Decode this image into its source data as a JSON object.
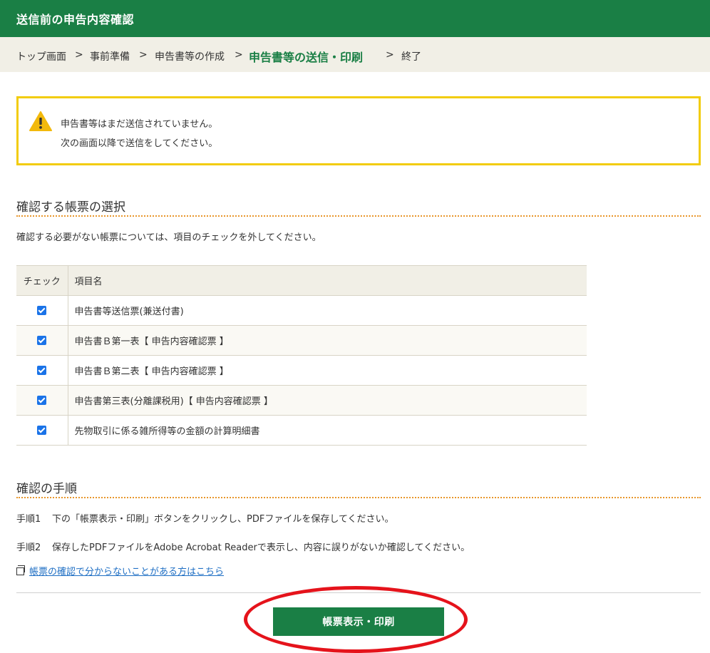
{
  "header": {
    "title": "送信前の申告内容確認"
  },
  "breadcrumb": {
    "items": [
      "トップ画面",
      "事前準備",
      "申告書等の作成",
      "申告書等の送信・印刷",
      "終了"
    ],
    "separator": ">"
  },
  "alert": {
    "icon": "warning-icon",
    "line1": "申告書等はまだ送信されていません。",
    "line2": "次の画面以降で送信をしてください。"
  },
  "select_section": {
    "title": "確認する帳票の選択",
    "note": "確認する必要がない帳票については、項目のチェックを外してください。",
    "columns": [
      "チェック",
      "項目名"
    ],
    "rows": [
      {
        "checked": true,
        "name": "申告書等送信票(兼送付書)"
      },
      {
        "checked": true,
        "name": "申告書Ｂ第一表【 申告内容確認票 】"
      },
      {
        "checked": true,
        "name": "申告書Ｂ第二表【 申告内容確認票 】"
      },
      {
        "checked": true,
        "name": "申告書第三表(分離課税用)【 申告内容確認票 】"
      },
      {
        "checked": true,
        "name": "先物取引に係る雑所得等の金額の計算明細書"
      }
    ]
  },
  "procedure": {
    "title": "確認の手順",
    "steps": [
      {
        "label": "手順1",
        "text": "下の「帳票表示・印刷」ボタンをクリックし、PDFファイルを保存してください。"
      },
      {
        "label": "手順2",
        "text": "保存したPDFファイルをAdobe Acrobat Readerで表示し、内容に誤りがないか確認してください。"
      }
    ],
    "help_link": "帳票の確認で分からないことがある方はこちら",
    "help_icon": "external-window-icon"
  },
  "actions": {
    "print_button": "帳票表示・印刷"
  },
  "colors": {
    "brand": "#1a7f45",
    "alert_border": "#f2cc0c",
    "annotation": "#e5131b"
  }
}
